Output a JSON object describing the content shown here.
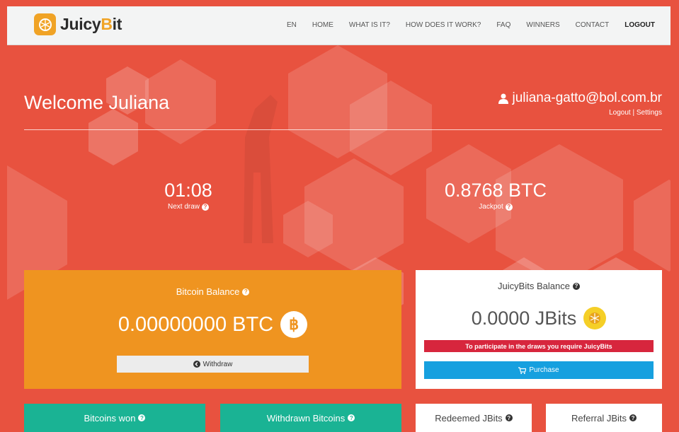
{
  "brand": {
    "name_pre": "Juicy",
    "name_b": "B",
    "name_post": "it",
    "accent": "#f0a326"
  },
  "nav": {
    "items": [
      "EN",
      "HOME",
      "WHAT IS IT?",
      "HOW DOES IT WORK?",
      "FAQ",
      "WINNERS",
      "CONTACT",
      "LOGOUT"
    ]
  },
  "welcome": {
    "text": "Welcome Juliana",
    "email": "juliana-gatto@bol.com.br",
    "logout_link": "Logout",
    "separator": "|",
    "settings_link": "Settings"
  },
  "stats": {
    "next_draw": {
      "value": "01:08",
      "label": "Next draw"
    },
    "jackpot": {
      "value": "0.8768 BTC",
      "label": "Jackpot"
    }
  },
  "bitcoin_balance": {
    "title": "Bitcoin Balance",
    "amount": "0.00000000 BTC",
    "coin_symbol": "฿",
    "withdraw_label": "Withdraw",
    "color": "#ef9420"
  },
  "juicybits_balance": {
    "title": "JuicyBits Balance",
    "amount": "0.0000 JBits",
    "alert": "To participate in the draws you require JuicyBits",
    "purchase_label": "Purchase",
    "alert_color": "#d7263d",
    "purchase_color": "#16a0df"
  },
  "bottom_tiles": {
    "bitcoins_won": "Bitcoins won",
    "withdrawn": "Withdrawn Bitcoins",
    "redeemed": "Redeemed JBits",
    "referral": "Referral JBits"
  },
  "colors": {
    "hero": "#e8523f",
    "green": "#1ab394"
  },
  "icons": {
    "question": "?",
    "user": "user-icon",
    "cart": "cart-icon",
    "arrow": "arrow-circle-icon"
  }
}
